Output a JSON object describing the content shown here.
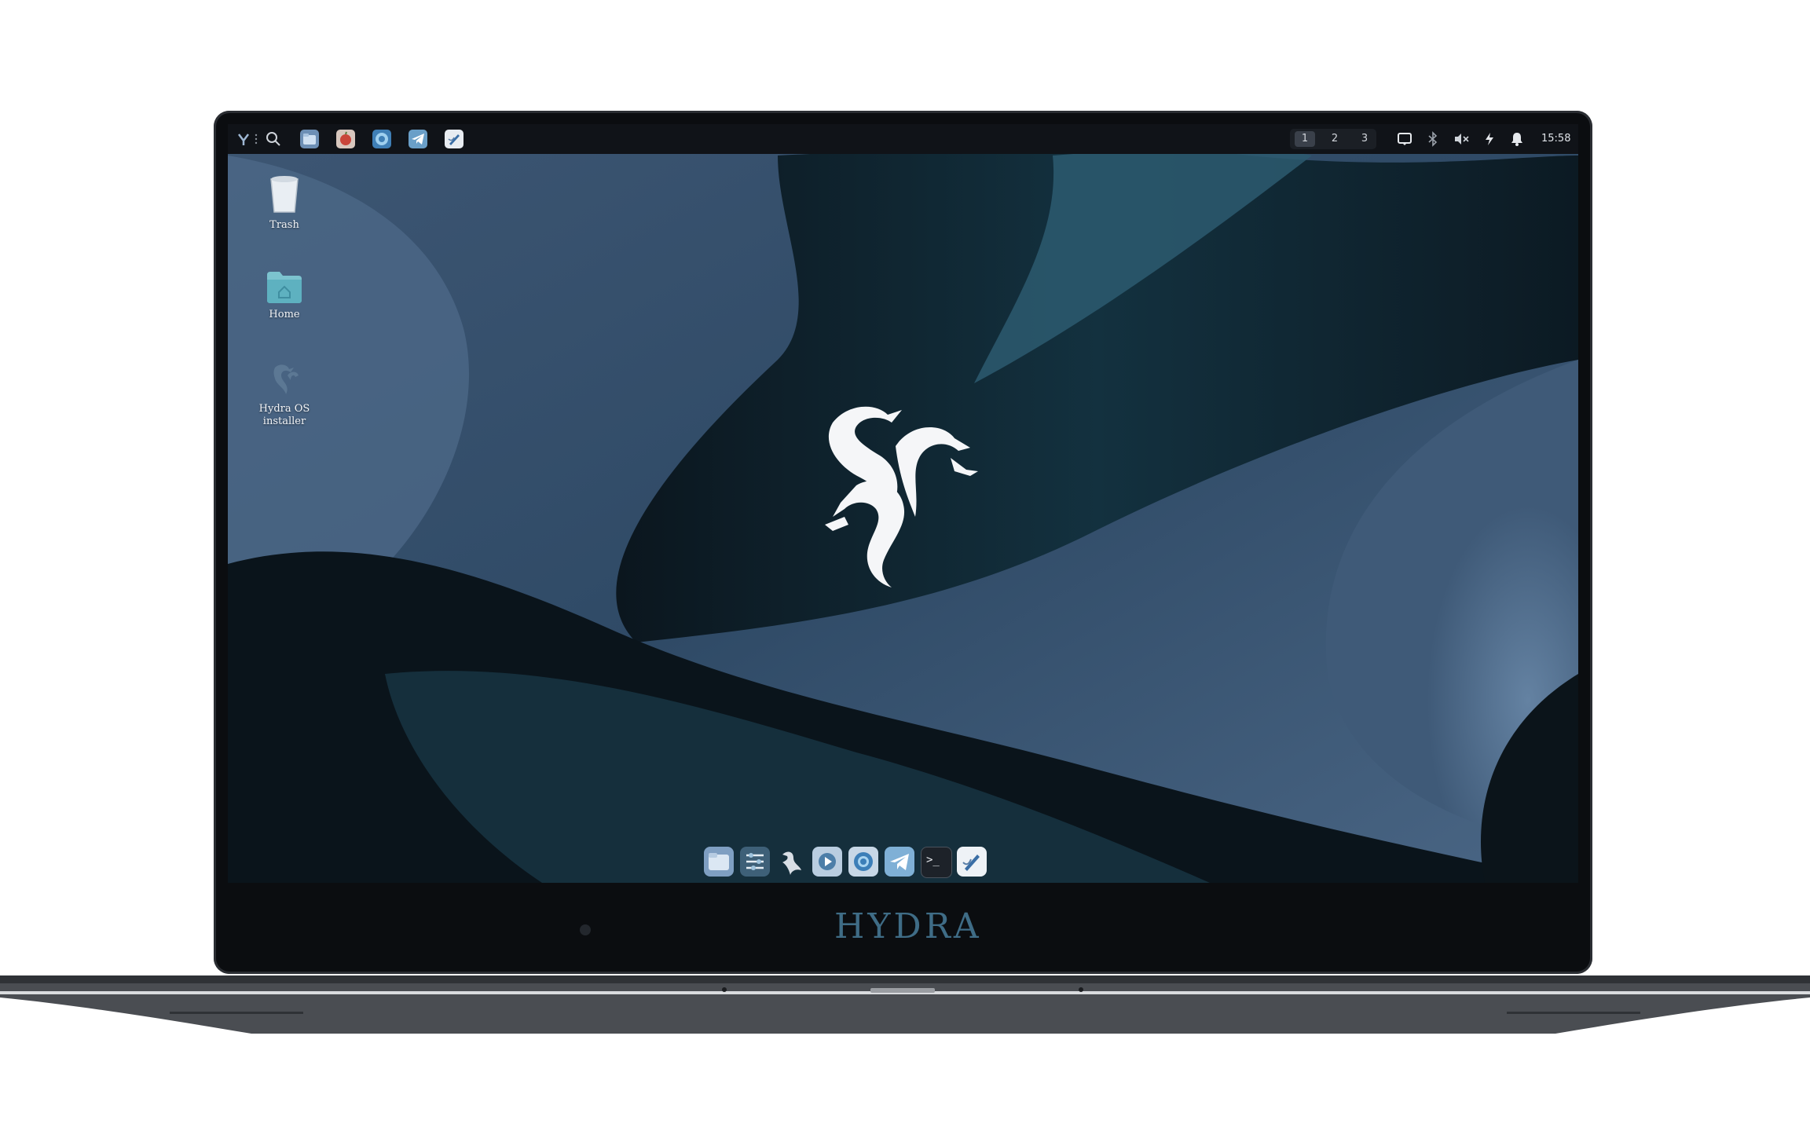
{
  "panel": {
    "workspaces": [
      "1",
      "2",
      "3"
    ],
    "active_workspace": "1",
    "clock": "15:58",
    "launcher_icons": [
      "hydra-menu-icon",
      "search-icon",
      "files-icon",
      "apple-app-icon",
      "browser-icon",
      "telegram-icon",
      "text-editor-icon"
    ],
    "tray_icons": [
      "screen-icon",
      "bluetooth-icon",
      "volume-muted-icon",
      "power-icon",
      "notification-bell-icon"
    ]
  },
  "desktop": {
    "icons": [
      {
        "label": "Trash",
        "icon": "trash-icon"
      },
      {
        "label": "Home",
        "icon": "home-folder-icon"
      },
      {
        "label": "Hydra OS installer",
        "icon": "hydra-installer-icon"
      }
    ]
  },
  "dock": {
    "items": [
      "files-icon",
      "settings-mixer-icon",
      "hydra-icon",
      "media-player-icon",
      "browser-icon",
      "telegram-icon",
      "terminal-icon",
      "text-editor-icon"
    ],
    "terminal_glyph": ">_"
  },
  "bezel": {
    "brand": "HYDRA"
  },
  "colors": {
    "accent": "#3f6c86",
    "panel_bg": "#101318",
    "wallpaper_light": "#4a6685",
    "wallpaper_dark": "#0e1a22"
  }
}
